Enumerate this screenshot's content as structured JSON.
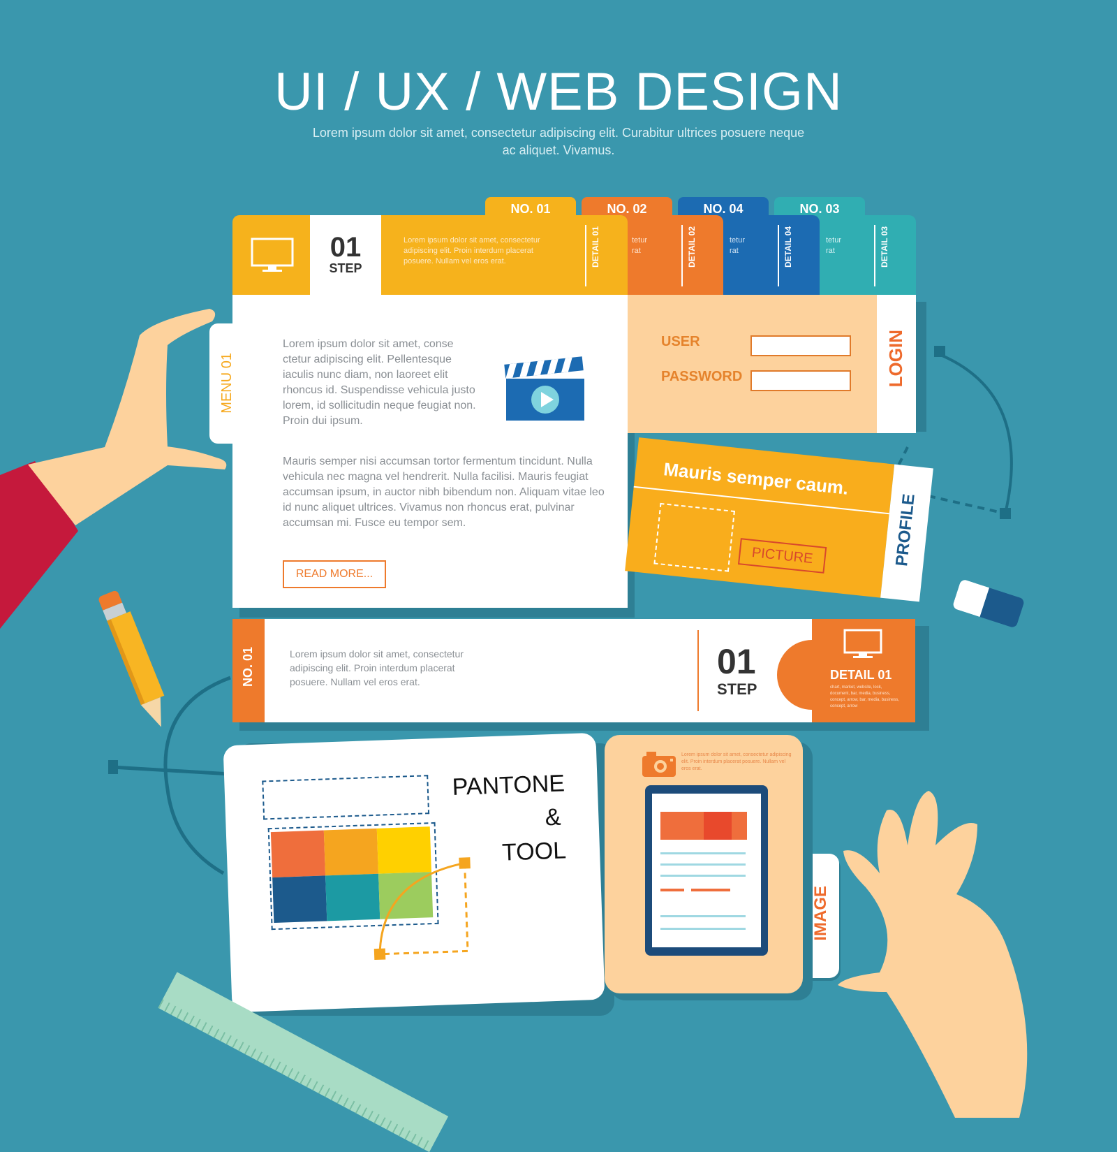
{
  "title": "UI / UX / WEB DESIGN",
  "subtitle": "Lorem ipsum dolor sit amet, consectetur adipiscing elit. Curabitur ultrices posuere neque ac aliquet. Vivamus.",
  "tabs": [
    {
      "label": "NO. 01",
      "color": "#f6b21c"
    },
    {
      "label": "NO. 02",
      "color": "#ee7a2c"
    },
    {
      "label": "NO. 04",
      "color": "#1c6bb2"
    },
    {
      "label": "NO. 03",
      "color": "#30aeb2"
    }
  ],
  "header": {
    "step_number": "01",
    "step_label": "STEP",
    "text": "Lorem ipsum dolor sit amet, consectetur adipiscing elit. Proin interdum placerat posuere. Nullam vel eros erat.",
    "details": [
      "DETAIL 01",
      "DETAIL 02",
      "DETAIL 04",
      "DETAIL 03"
    ],
    "partial_text_a": "tetur",
    "partial_text_b": "rat"
  },
  "menu": {
    "label": "MENU 01",
    "paragraph1": "Lorem ipsum dolor sit amet, conse ctetur adipiscing elit. Pellentesque iaculis nunc diam, non laoreet elit rhoncus id. Suspendisse vehicula justo lorem, id sollicitudin neque feugiat non. Proin dui ipsum.",
    "paragraph2": "Mauris semper nisi accumsan tortor fermentum tincidunt. Nulla vehicula nec magna vel hendrerit. Nulla facilisi. Mauris feugiat accumsan ipsum, in auctor nibh bibendum non. Aliquam vitae leo id nunc aliquet ultrices. Vivamus non rhoncus erat, pulvinar accumsan mi. Fusce eu tempor sem.",
    "read_more": "READ MORE..."
  },
  "login": {
    "label": "LOGIN",
    "user_label": "USER",
    "password_label": "PASSWORD",
    "user_value": "",
    "password_value": ""
  },
  "profile": {
    "label": "PROFILE",
    "heading": "Mauris semper caum.",
    "picture": "PICTURE"
  },
  "step_bar": {
    "label": "NO. 01",
    "text": "Lorem ipsum dolor sit amet, consectetur adipiscing elit. Proin interdum placerat posuere. Nullam vel eros erat.",
    "step_number": "01",
    "step_label": "STEP",
    "detail": "DETAIL 01",
    "detail_small": "chart, market, website, lock, document, bar, media, business, concept, arrow, bar, media, business, concept, arrow"
  },
  "pantone": {
    "line1": "PANTONE",
    "line2": "&",
    "line3": "TOOL",
    "swatches": [
      "#ef6e3c",
      "#f5a51f",
      "#ffd000",
      "#1c5a8c",
      "#1c9aa3",
      "#9ccc5e"
    ]
  },
  "image_card": {
    "label": "IMAGE",
    "text": "Lorem ipsum dolor sit amet, consectetur adipiscing elit. Proin interdum placerat posuere. Nullam vel eros erat."
  },
  "detail_small_text": "chart, market, website, lock, document, bar, media, business, concept, arrow"
}
